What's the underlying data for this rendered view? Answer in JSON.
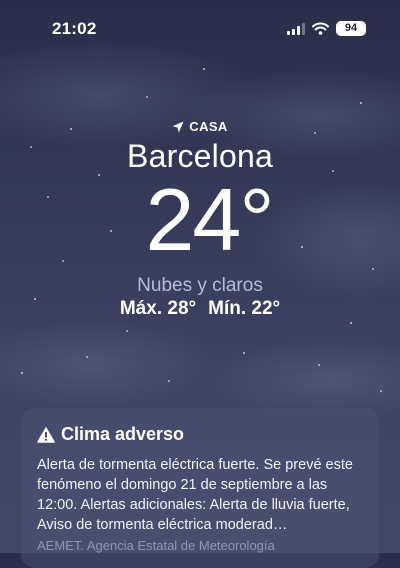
{
  "status_bar": {
    "time": "21:02",
    "battery": "94"
  },
  "header": {
    "location_label": "CASA",
    "city": "Barcelona",
    "temperature": "24°",
    "condition": "Nubes y claros",
    "max": "Máx. 28°",
    "min": "Mín. 22°"
  },
  "alert": {
    "title": "Clima adverso",
    "body": "Alerta de tormenta eléctrica fuerte. Se prevé este fenómeno el domingo 21 de septiembre a las 12:00. Alertas adicionales: Alerta de lluvia fuerte, Aviso de tormenta eléctrica moderad…",
    "source": "AEMET. Agencia Estatal de Meteorología"
  },
  "icons": {
    "location": "location-arrow-icon",
    "signal": "cellular-signal-icon",
    "wifi": "wifi-icon",
    "battery": "battery-icon",
    "warning": "warning-triangle-icon"
  },
  "colors": {
    "background_top": "#2a2e4a",
    "background_bottom": "#434868",
    "card": "rgba(80,86,120,0.45)"
  }
}
